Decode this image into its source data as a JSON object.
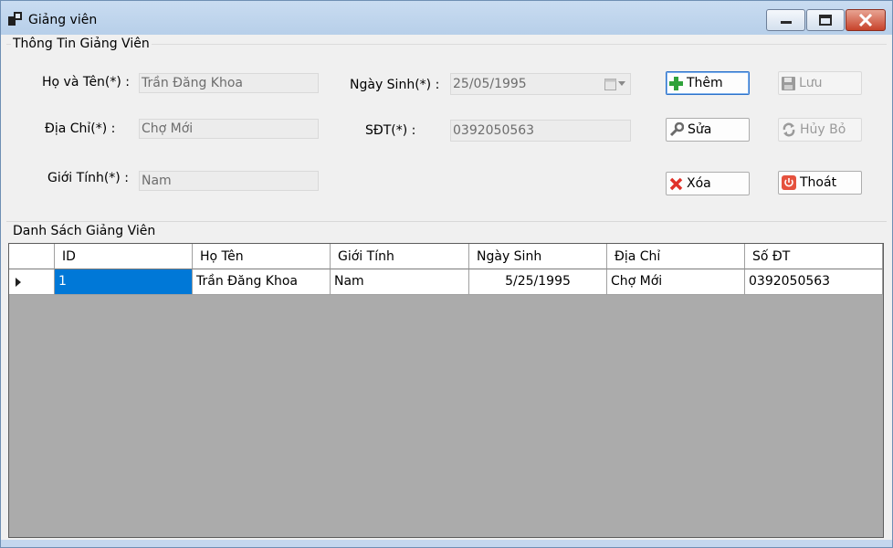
{
  "window": {
    "title": "Giảng viên"
  },
  "info_group": {
    "legend": "Thông Tin Giảng Viên",
    "name_label": "Họ và Tên(*) :",
    "name_value": "Trần Đăng Khoa",
    "address_label": "Địa Chỉ(*) :",
    "address_value": "Chợ Mới",
    "gender_label": "Giới Tính(*) :",
    "gender_value": "Nam",
    "birth_label": "Ngày Sinh(*) :",
    "birth_value": "25/05/1995",
    "phone_label": "SĐT(*) :",
    "phone_value": "0392050563"
  },
  "buttons": {
    "add": "Thêm",
    "save": "Lưu",
    "edit": "Sửa",
    "cancel": "Hủy Bỏ",
    "delete": "Xóa",
    "exit": "Thoát"
  },
  "list_group": {
    "legend": "Danh Sách Giảng Viên"
  },
  "grid": {
    "columns": [
      "ID",
      "Họ Tên",
      "Giới Tính",
      "Ngày Sinh",
      "Địa Chỉ",
      "Số ĐT"
    ],
    "rows": [
      [
        "1",
        "Trần Đăng Khoa",
        "Nam",
        "5/25/1995",
        "Chợ Mới",
        "0392050563"
      ]
    ],
    "selection_color": "#0078d7"
  }
}
